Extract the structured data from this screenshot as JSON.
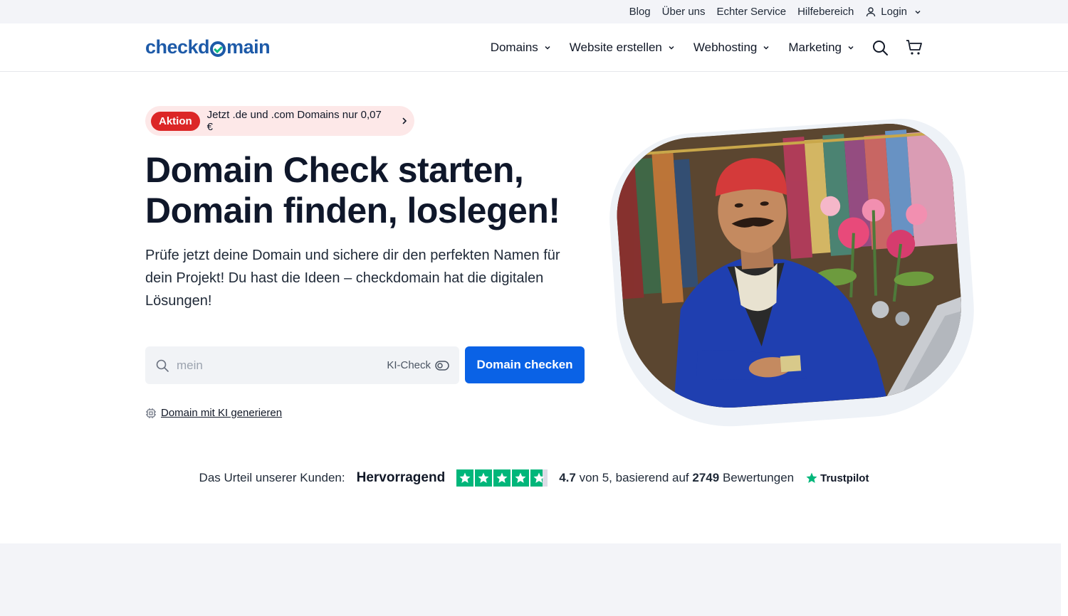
{
  "topbar": {
    "links": [
      "Blog",
      "Über uns",
      "Echter Service",
      "Hilfebereich"
    ],
    "login_label": "Login"
  },
  "nav": {
    "logo_text_prefix": "checkd",
    "logo_text_suffix": "main",
    "items": [
      "Domains",
      "Website erstellen",
      "Webhosting",
      "Marketing"
    ]
  },
  "hero": {
    "promo_badge": "Aktion",
    "promo_text": "Jetzt .de und .com Domains nur 0,07 €",
    "title_line1": "Domain Check starten,",
    "title_line2": "Domain finden, loslegen!",
    "subtitle": "Prüfe jetzt deine Domain und sichere dir den perfekten Namen für dein Projekt! Du hast die Ideen – checkdomain hat die digitalen Lösungen!",
    "search_placeholder": "mein",
    "ki_check_label": "KI-Check",
    "cta_label": "Domain checken",
    "ki_link_label": "Domain mit KI generieren"
  },
  "trust": {
    "intro": "Das Urteil unserer Kunden:",
    "verdict": "Hervorragend",
    "rating": 4.7,
    "stars_filled": 4.7,
    "rating_text": "4.7",
    "rating_mid": "von 5, basierend auf",
    "review_count": "2749",
    "reviews_word": "Bewertungen",
    "brand": "Trustpilot"
  },
  "colors": {
    "brand_blue": "#1d5aa8",
    "cta_blue": "#0a62e6",
    "promo_red": "#dc2626",
    "trustpilot_green": "#00b67a"
  }
}
